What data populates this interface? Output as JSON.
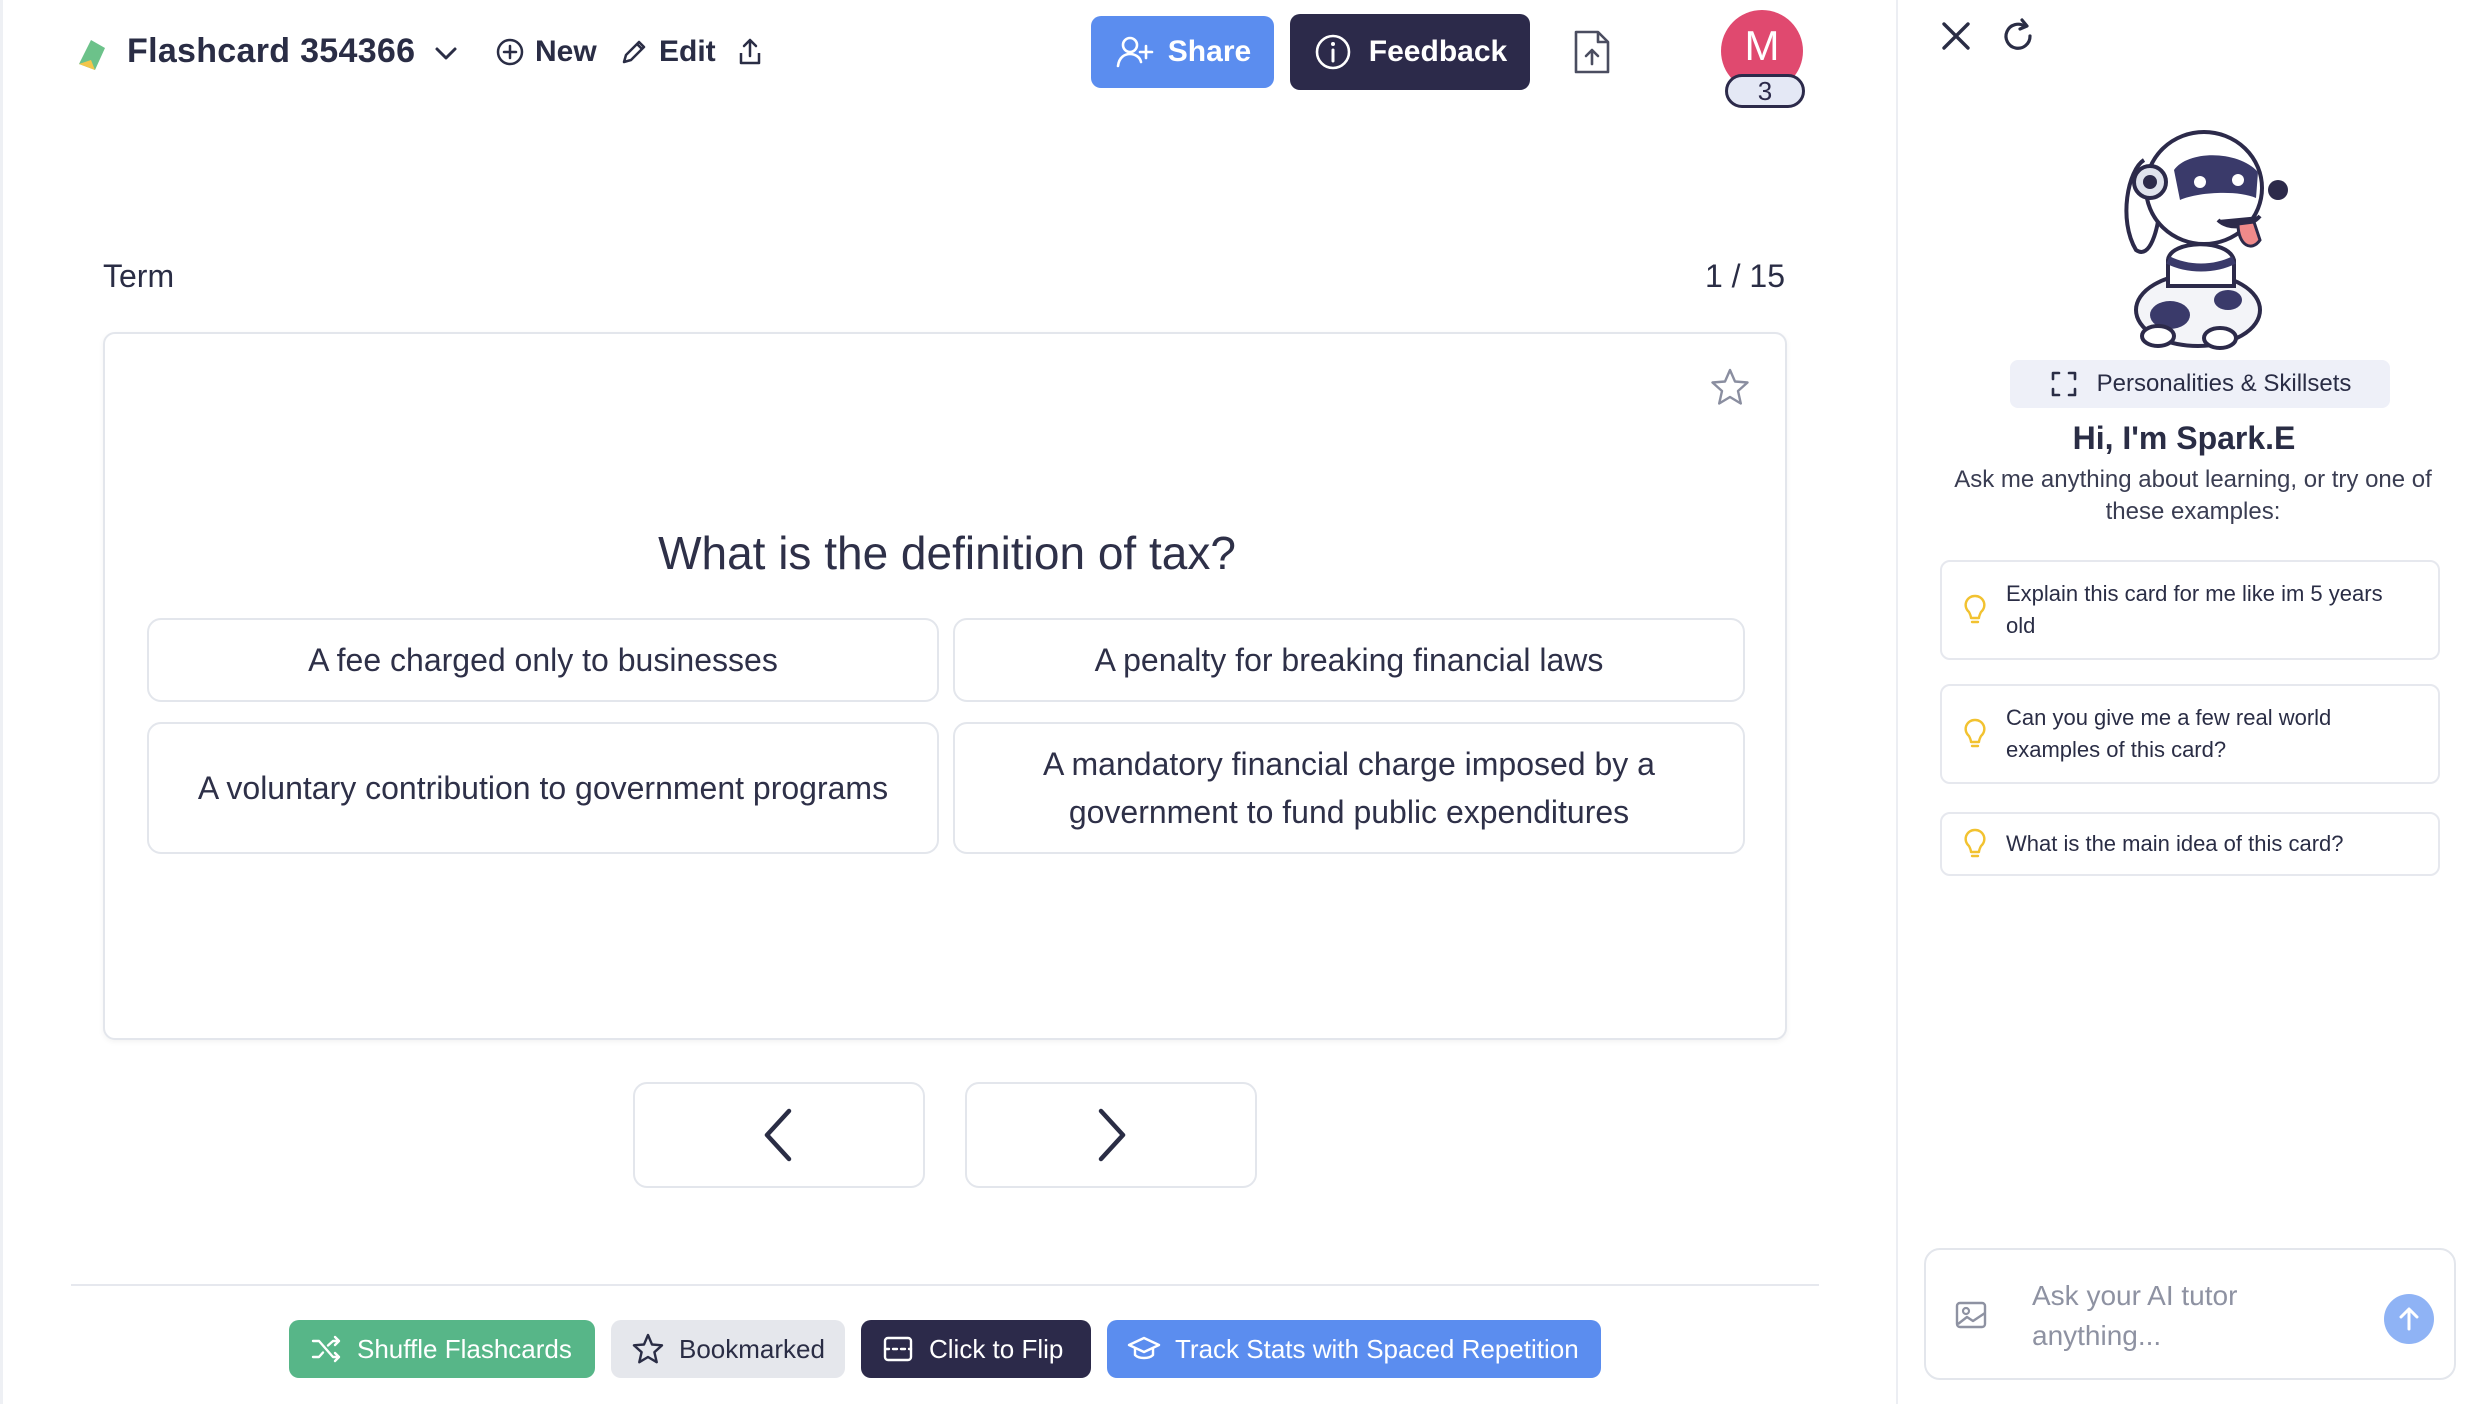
{
  "header": {
    "title": "Flashcard 354366",
    "new_label": "New",
    "edit_label": "Edit",
    "share_label": "Share",
    "feedback_label": "Feedback",
    "avatar_initial": "M",
    "avatar_badge": "3"
  },
  "card": {
    "side_label": "Term",
    "counter": "1 / 15",
    "question": "What is the definition of tax?",
    "options": [
      "A fee charged only to businesses",
      "A penalty for breaking financial laws",
      "A voluntary contribution to government programs",
      "A mandatory financial charge imposed by a government to fund public expenditures"
    ]
  },
  "toolbar": {
    "shuffle_label": "Shuffle Flashcards",
    "bookmarked_label": "Bookmarked",
    "flip_label": "Click to Flip",
    "track_label": "Track Stats with Spaced Repetition"
  },
  "panel": {
    "personality_label": "Personalities & Skillsets",
    "greeting": "Hi, I'm Spark.E",
    "intro": "Ask me anything about learning, or try one of these examples:",
    "suggestions": [
      "Explain this card for me like im 5 years old",
      "Can you give me a few real world examples of this card?",
      "What is the main idea of this card?"
    ],
    "chat_placeholder": "Ask your AI tutor anything..."
  },
  "colors": {
    "primary_dark": "#2c2a4a",
    "accent_blue": "#5b8def",
    "shuffle_green": "#57b688",
    "avatar_pink": "#e0496f"
  },
  "icons": [
    "logo-icon",
    "chevron-down-icon",
    "plus-circle-icon",
    "pencil-icon",
    "export-icon",
    "add-user-icon",
    "info-icon",
    "file-upload-icon",
    "star-icon",
    "chevron-left-icon",
    "chevron-right-icon",
    "shuffle-icon",
    "flip-icon",
    "graduation-cap-icon",
    "close-icon",
    "refresh-icon",
    "expand-icon",
    "lightbulb-icon",
    "image-icon",
    "arrow-up-icon"
  ]
}
